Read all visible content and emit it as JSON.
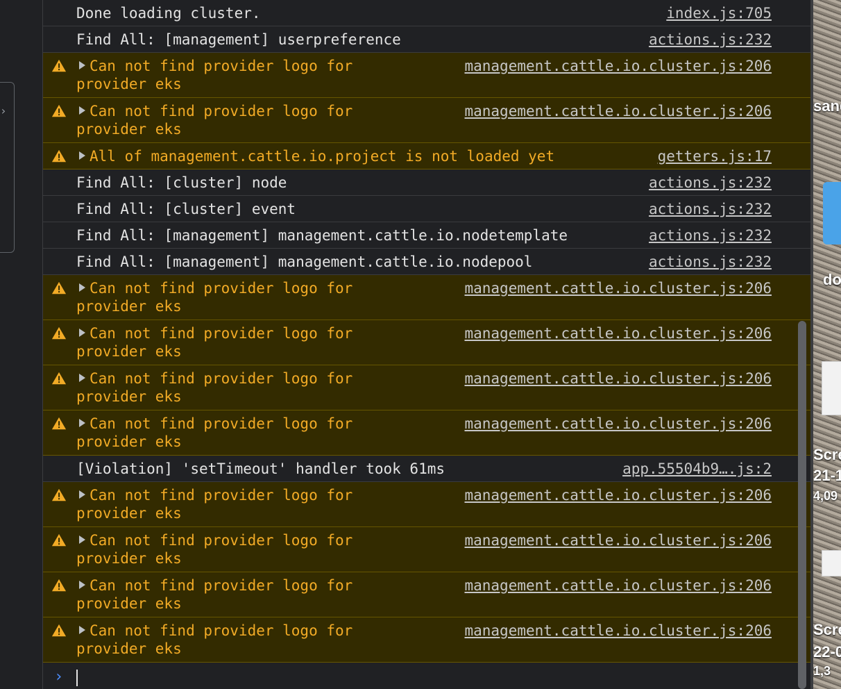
{
  "rows": [
    {
      "type": "info",
      "message": "Done loading cluster.",
      "source": "index.js:705"
    },
    {
      "type": "info",
      "message": "Find All: [management] userpreference",
      "source": "actions.js:232"
    },
    {
      "type": "warn",
      "line1": "Can not find provider logo for",
      "line2": "provider eks",
      "source": "management.cattle.io.cluster.js:206"
    },
    {
      "type": "warn",
      "line1": "Can not find provider logo for",
      "line2": "provider eks",
      "source": "management.cattle.io.cluster.js:206"
    },
    {
      "type": "warn",
      "line1": "All of management.cattle.io.project is not loaded yet",
      "source": "getters.js:17"
    },
    {
      "type": "info",
      "message": "Find All: [cluster] node",
      "source": "actions.js:232"
    },
    {
      "type": "info",
      "message": "Find All: [cluster] event",
      "source": "actions.js:232"
    },
    {
      "type": "info",
      "message": "Find All: [management] management.cattle.io.nodetemplate",
      "source": "actions.js:232"
    },
    {
      "type": "info",
      "message": "Find All: [management] management.cattle.io.nodepool",
      "source": "actions.js:232"
    },
    {
      "type": "warn",
      "line1": "Can not find provider logo for",
      "line2": "provider eks",
      "source": "management.cattle.io.cluster.js:206"
    },
    {
      "type": "warn",
      "line1": "Can not find provider logo for",
      "line2": "provider eks",
      "source": "management.cattle.io.cluster.js:206"
    },
    {
      "type": "warn",
      "line1": "Can not find provider logo for",
      "line2": "provider eks",
      "source": "management.cattle.io.cluster.js:206"
    },
    {
      "type": "warn",
      "line1": "Can not find provider logo for",
      "line2": "provider eks",
      "source": "management.cattle.io.cluster.js:206"
    },
    {
      "type": "violation",
      "message": "[Violation] 'setTimeout' handler took 61ms",
      "source": "app.55504b9….js:2"
    },
    {
      "type": "warn",
      "line1": "Can not find provider logo for",
      "line2": "provider eks",
      "source": "management.cattle.io.cluster.js:206"
    },
    {
      "type": "warn",
      "line1": "Can not find provider logo for",
      "line2": "provider eks",
      "source": "management.cattle.io.cluster.js:206"
    },
    {
      "type": "warn",
      "line1": "Can not find provider logo for",
      "line2": "provider eks",
      "source": "management.cattle.io.cluster.js:206"
    },
    {
      "type": "warn",
      "line1": "Can not find provider logo for",
      "line2": "provider eks",
      "source": "management.cattle.io.cluster.js:206"
    }
  ],
  "prompt": {
    "symbol": "›",
    "value": ""
  },
  "icons": {
    "warning": "warning-icon",
    "expand": "expand-triangle-icon",
    "prompt": "prompt-chevron-icon"
  },
  "colors": {
    "background": "#202124",
    "warning_bg": "#332b00",
    "warning_text": "#f2ab26",
    "text": "#e3e3e3",
    "link": "#c7c7c7",
    "prompt": "#4d90fe"
  },
  "desktop": {
    "labels": [
      "sand",
      "do",
      "Scre",
      "21-1",
      "4,09",
      "Scre",
      "22-0",
      "1,3"
    ]
  }
}
